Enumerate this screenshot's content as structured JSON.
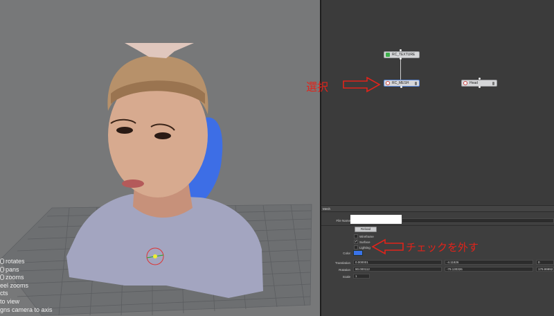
{
  "viewport": {
    "help_lines": [
      {
        "mouse": true,
        "text": "rotates"
      },
      {
        "mouse": true,
        "text": "pans"
      },
      {
        "mouse": true,
        "text": "zooms"
      },
      {
        "mouse": false,
        "text": "eel zooms"
      },
      {
        "mouse": false,
        "text": "cts"
      },
      {
        "mouse": false,
        "text": "to view"
      },
      {
        "mouse": false,
        "text": "gns camera to axis"
      }
    ]
  },
  "graph": {
    "nodes": {
      "texture": "RC_TEXTURE",
      "mesh": "RC_MESH",
      "head": "Head"
    },
    "annotation_select": "選択"
  },
  "attributes": {
    "title": "Mesh",
    "file_name_label": "File Name",
    "reload_label": "Reload",
    "wireframe_label": "Wireframe",
    "surface_label": "Surface",
    "lighting_label": "Lighting",
    "wireframe_checked": false,
    "surface_checked": true,
    "lighting_checked": false,
    "color_label": "Color",
    "color_value": "#3a73ea",
    "translation_label": "Translation",
    "translation": [
      "0.000001",
      "-4.11826",
      "0"
    ],
    "rotation_label": "Rotation",
    "rotation": [
      "90.000112",
      "-79.130326",
      "179.99992"
    ],
    "scale_label": "Scale",
    "scale": "1",
    "annotation_uncheck": "チェックを外す"
  },
  "colors": {
    "annotation_red": "#e2231a",
    "viewport_bg": "#777879",
    "graph_bg": "#3b3b3b",
    "panel_bg": "#3e3e3e"
  }
}
